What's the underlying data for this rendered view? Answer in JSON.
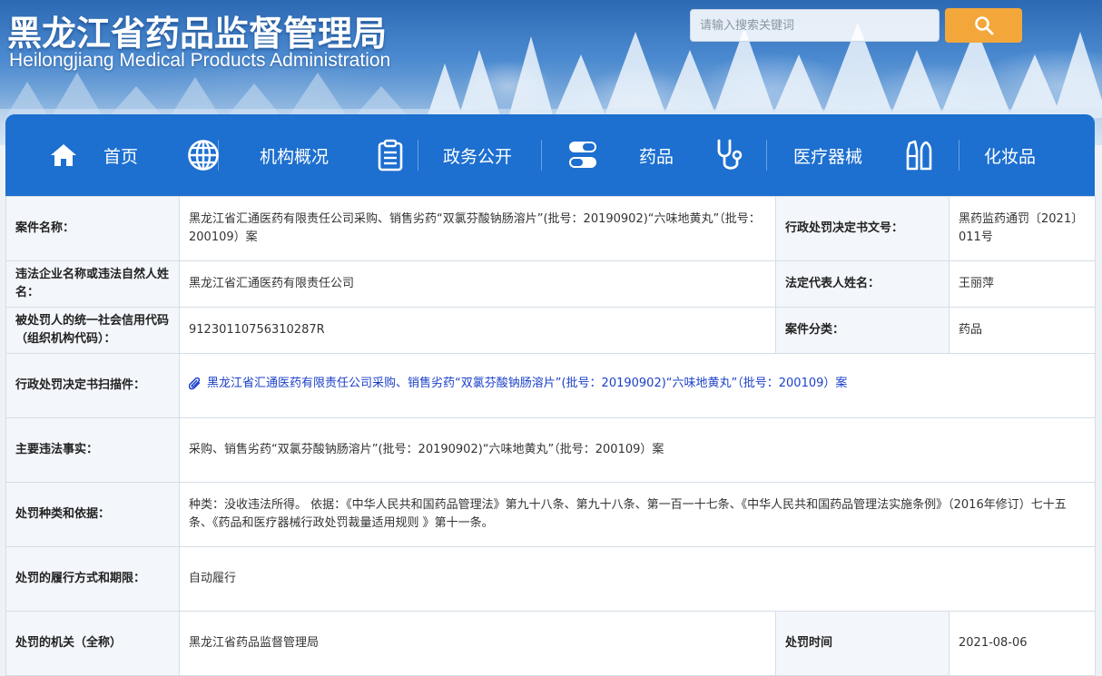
{
  "header": {
    "title_cn": "黑龙江省药品监督管理局",
    "title_en": "Heilongjiang Medical Products Administration",
    "search": {
      "placeholder": "请输入搜索关键词",
      "value": ""
    },
    "search_button_icon": "search-icon"
  },
  "nav": {
    "items": [
      {
        "label": "首页",
        "icon": "home-icon"
      },
      {
        "label": "机构概况",
        "icon": "globe-icon"
      },
      {
        "label": "政务公开",
        "icon": "clipboard-icon"
      },
      {
        "label": "药品",
        "icon": "pills-icon"
      },
      {
        "label": "医疗器械",
        "icon": "stethoscope-icon"
      },
      {
        "label": "化妆品",
        "icon": "cosmetics-icon"
      }
    ]
  },
  "record": {
    "case_name": {
      "label": "案件名称：",
      "value": "黑龙江省汇通医药有限责任公司采购、销售劣药“双氯芬酸钠肠溶片”(批号：20190902)“六味地黄丸”（批号：200109）案"
    },
    "doc_number": {
      "label": "行政处罚决定书文号：",
      "value": "黑药监药通罚〔2021〕011号"
    },
    "party": {
      "label": "违法企业名称或违法自然人姓名：",
      "value": "黑龙江省汇通医药有限责任公司"
    },
    "legal_rep": {
      "label": "法定代表人姓名：",
      "value": "王丽萍"
    },
    "credit_code": {
      "label": "被处罚人的统一社会信用代码（组织机构代码）：",
      "value": "91230110756310287R"
    },
    "category": {
      "label": "案件分类：",
      "value": "药品"
    },
    "scan": {
      "label": "行政处罚决定书扫描件：",
      "value": "黑龙江省汇通医药有限责任公司采购、销售劣药“双氯芬酸钠肠溶片”(批号：20190902)“六味地黄丸”（批号：200109）案",
      "icon": "paperclip-icon"
    },
    "facts": {
      "label": "主要违法事实：",
      "value": "采购、销售劣药“双氯芬酸钠肠溶片”(批号：20190902)“六味地黄丸”（批号：200109）案"
    },
    "penalty": {
      "label": "处罚种类和依据：",
      "value": "种类：没收违法所得。 依据：《中华人民共和国药品管理法》第九十八条、第九十八条、第一百一十七条、《中华人民共和国药品管理法实施条例》（2016年修订）七十五条、《药品和医疗器械行政处罚裁量适用规则 》第十一条。"
    },
    "execution": {
      "label": "处罚的履行方式和期限：",
      "value": "自动履行"
    },
    "authority": {
      "label": "处罚的机关（全称）",
      "value": "黑龙江省药品监督管理局"
    },
    "date": {
      "label": "处罚时间",
      "value": "2021-08-06"
    }
  },
  "colors": {
    "nav_bg": "#1d6fd0",
    "search_button": "#f3a73b",
    "link": "#1a3fc9",
    "label_bg": "#f3f7fb"
  }
}
